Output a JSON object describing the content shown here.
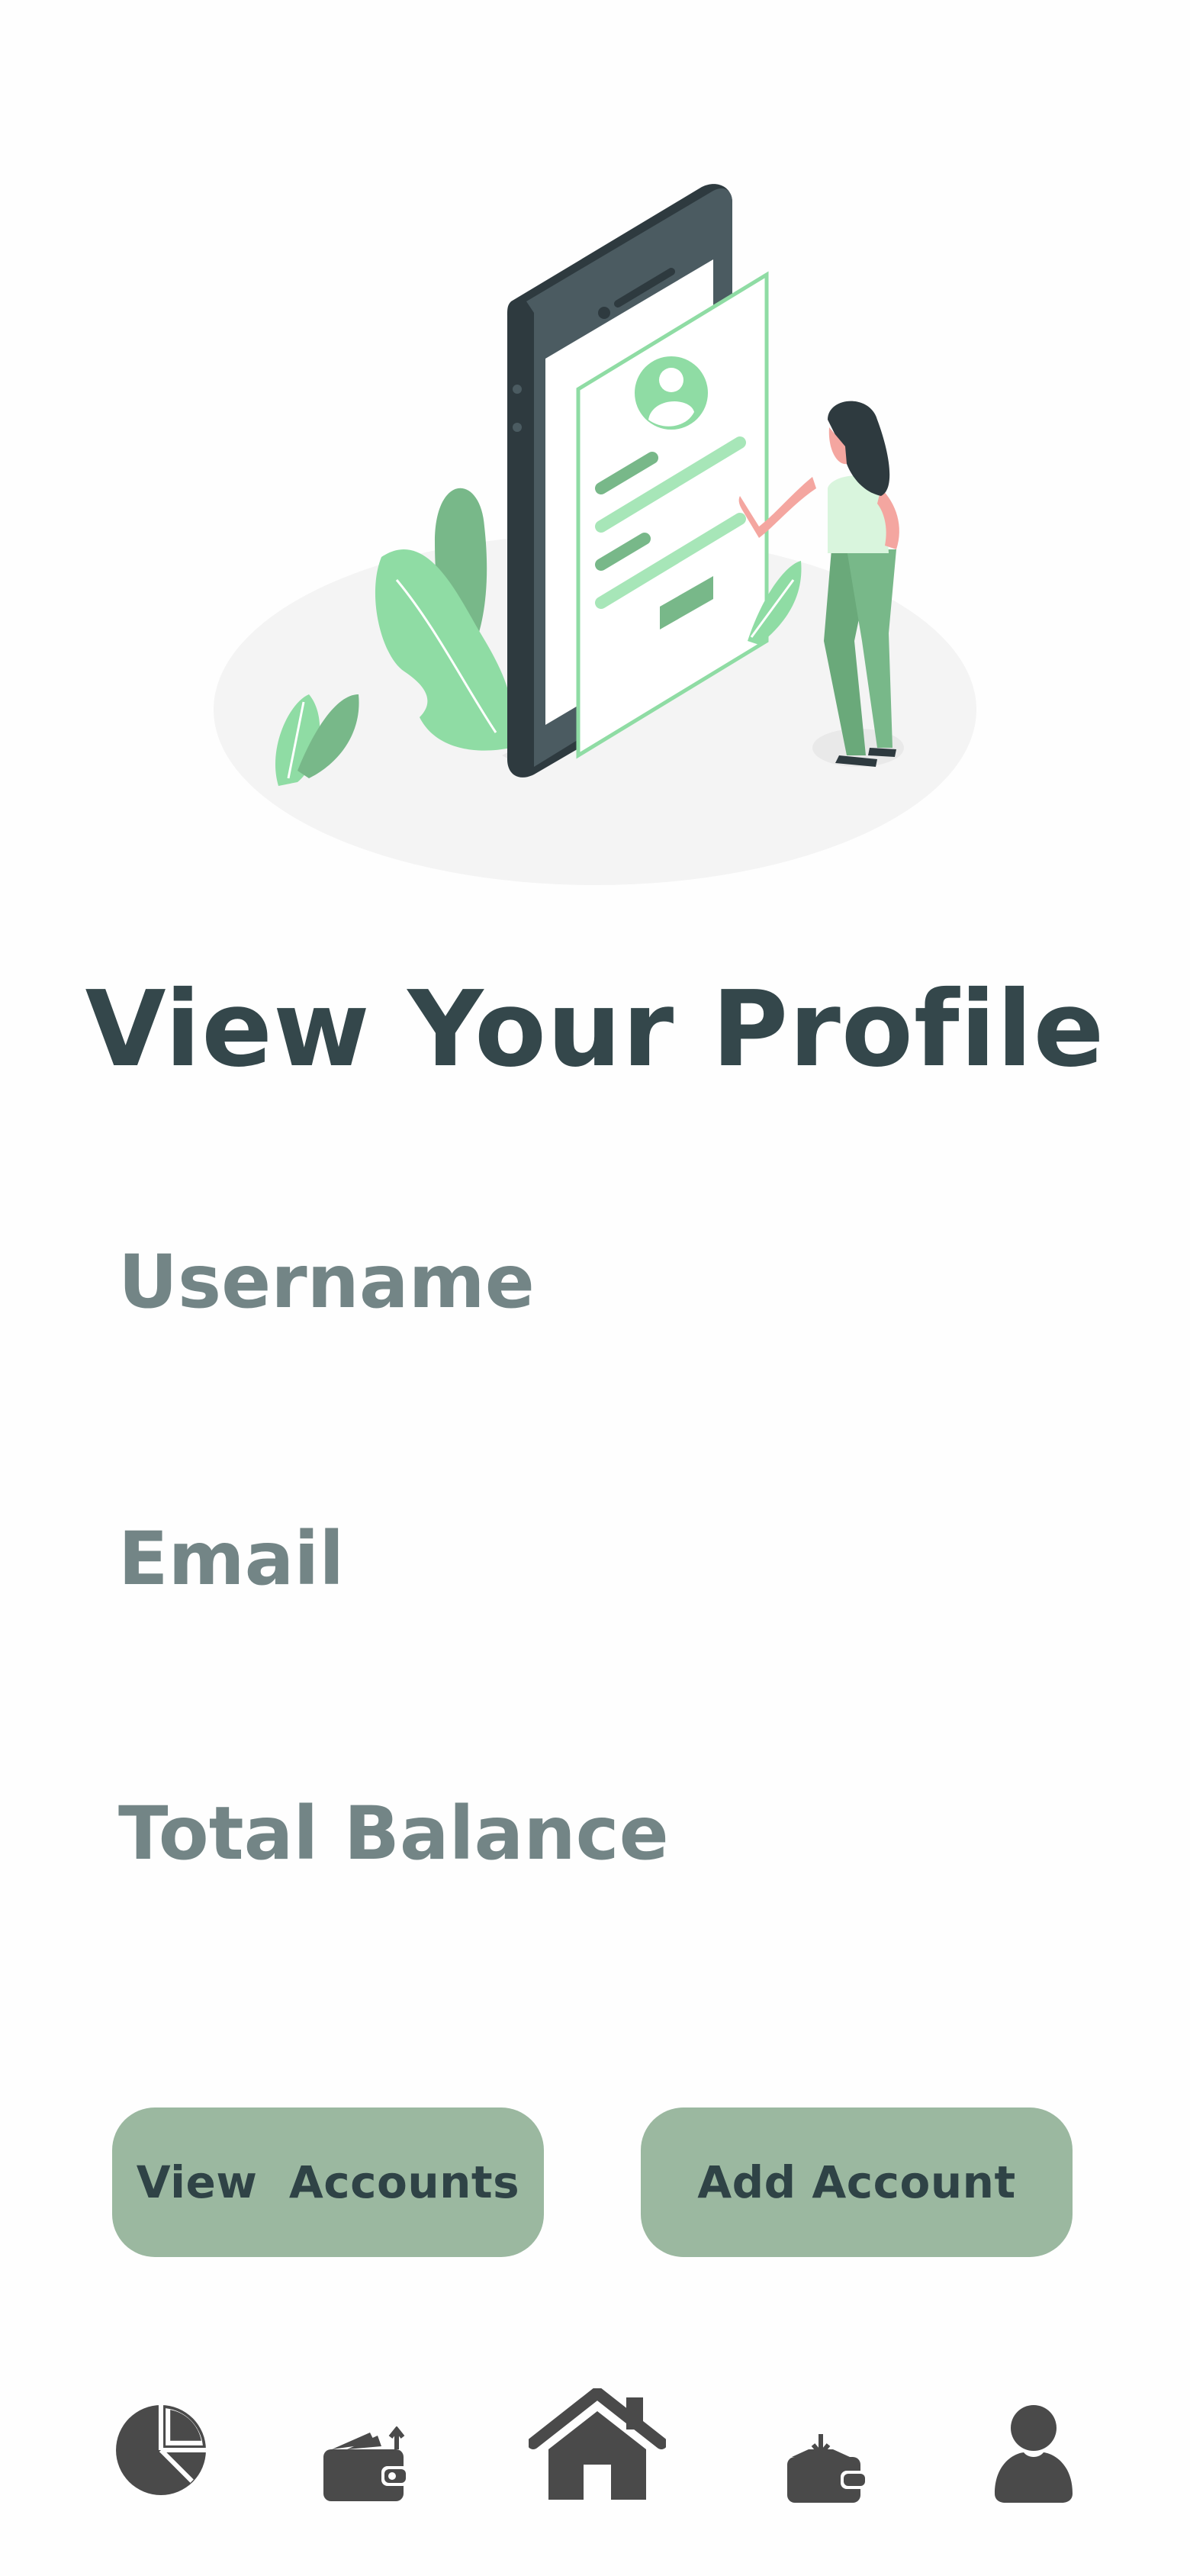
{
  "page": {
    "title": "View Your Profile"
  },
  "fields": {
    "username_label": "Username",
    "email_label": "Email",
    "total_balance_label": "Total Balance"
  },
  "actions": {
    "view_accounts_label": "View  Accounts",
    "add_account_label": "Add Account"
  },
  "bottom_nav": {
    "items": [
      {
        "icon": "pie-chart-icon"
      },
      {
        "icon": "wallet-send-icon"
      },
      {
        "icon": "home-icon"
      },
      {
        "icon": "wallet-receive-icon"
      },
      {
        "icon": "user-icon"
      }
    ]
  },
  "colors": {
    "background": "#fefefe",
    "title": "#34474b",
    "label": "#738586",
    "button_bg": "#9bb8a0",
    "button_text": "#2f4346",
    "nav_icon": "#4a4a4a",
    "accent_green": "#8fdca4"
  }
}
